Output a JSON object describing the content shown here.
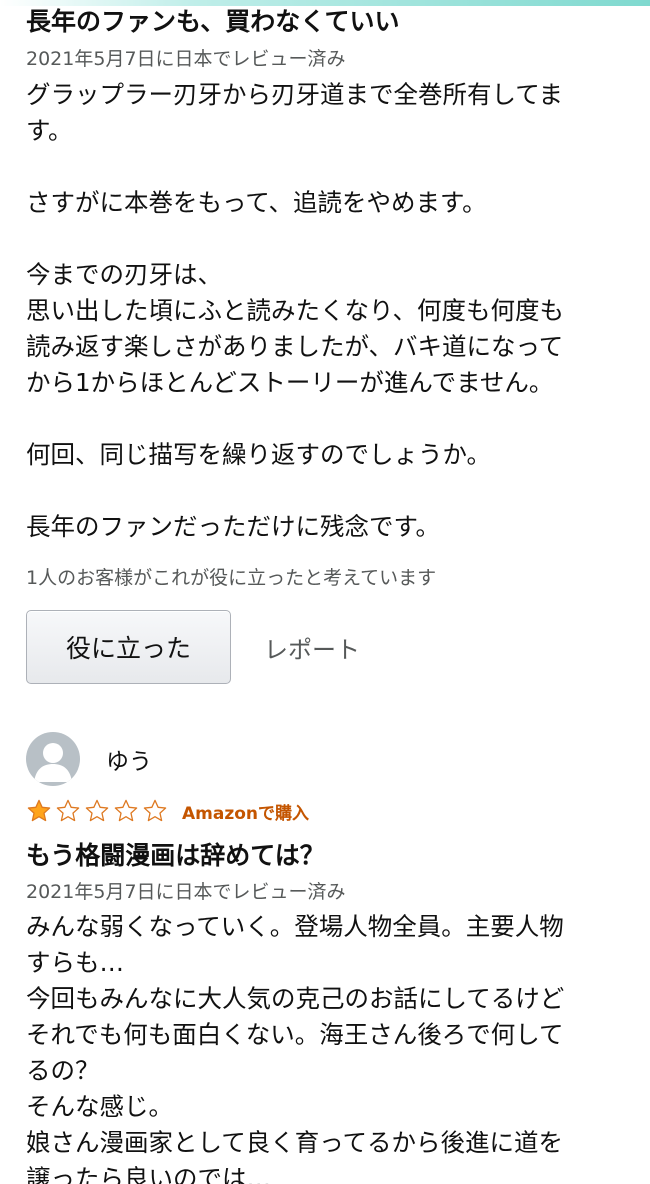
{
  "colors": {
    "accent_bar": "#7fd9cf",
    "meta_text": "#565959",
    "star_fill": "#ffa41c",
    "verified_badge": "#c45500"
  },
  "review1": {
    "title": "長年のファンも、買わなくていい",
    "meta": "2021年5月7日に日本でレビュー済み",
    "body": [
      "グラップラー刃牙から刃牙道まで全巻所有してま",
      "す。",
      "",
      "さすがに本巻をもって、追読をやめます。",
      "",
      "今までの刃牙は、",
      "思い出した頃にふと読みたくなり、何度も何度も",
      "読み返す楽しさがありましたが、バキ道になって",
      "から1からほとんどストーリーが進んでません。",
      "",
      "何回、同じ描写を繰り返すのでしょうか。",
      "",
      "長年のファンだっただけに残念です。"
    ],
    "helpful_count": "1人のお客様がこれが役に立ったと考えています",
    "helpful_button": "役に立った",
    "report_link": "レポート"
  },
  "review2": {
    "reviewer_name": "ゆう",
    "avatar_icon": "user-avatar-icon",
    "rating": 1,
    "rating_max": 5,
    "verified": "Amazonで購入",
    "title": "もう格闘漫画は辞めては？",
    "meta": "2021年5月7日に日本でレビュー済み",
    "body": [
      "みんな弱くなっていく。登場人物全員。主要人物",
      "すらも…",
      "今回もみんなに大人気の克己のお話にしてるけど",
      "それでも何も面白くない。海王さん後ろで何して",
      "るの？",
      "そんな感じ。",
      "娘さん漫画家として良く育ってるから後進に道を",
      "譲ったら良いのでは…"
    ]
  }
}
